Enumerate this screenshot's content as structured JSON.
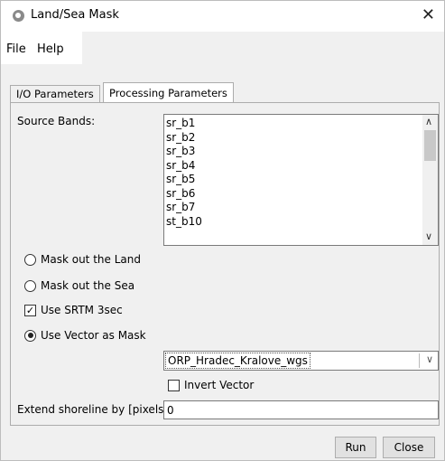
{
  "window": {
    "title": "Land/Sea Mask",
    "close_glyph": "✕",
    "icon": "app-logo-icon"
  },
  "menu": {
    "items": [
      "File",
      "Help"
    ]
  },
  "tabs": [
    {
      "label": "I/O Parameters",
      "selected": false
    },
    {
      "label": "Processing Parameters",
      "selected": true
    }
  ],
  "source_bands": {
    "label": "Source Bands:",
    "items": [
      "sr_b1",
      "sr_b2",
      "sr_b3",
      "sr_b4",
      "sr_b5",
      "sr_b6",
      "sr_b7",
      "st_b10"
    ]
  },
  "options": {
    "mask_land": {
      "label": "Mask out the Land",
      "selected": false
    },
    "mask_sea": {
      "label": "Mask out the Sea",
      "selected": false
    },
    "use_srtm": {
      "label": "Use SRTM 3sec",
      "checked": true
    },
    "use_vector": {
      "label": "Use Vector as Mask",
      "selected": true
    }
  },
  "vector_select": {
    "value": "ORP_Hradec_Kralove_wgs"
  },
  "invert_vector": {
    "label": "Invert Vector",
    "checked": false
  },
  "shoreline": {
    "label": "Extend shoreline by [pixels]:",
    "value": "0"
  },
  "buttons": {
    "run": "Run",
    "close": "Close"
  }
}
